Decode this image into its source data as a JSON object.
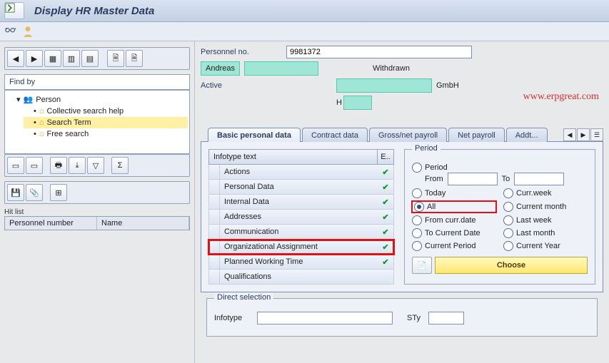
{
  "title": "Display HR Master Data",
  "findby_label": "Find by",
  "tree": {
    "root": "Person",
    "items": [
      "Collective search help",
      "Search Term",
      "Free search"
    ],
    "selected": 1
  },
  "hitlist": {
    "label": "Hit list",
    "col1": "Personnel number",
    "col2": "Name"
  },
  "personnel": {
    "label": "Personnel no.",
    "value": "9981372",
    "name": "Andreas",
    "status": "Withdrawn",
    "active": "Active",
    "company_suffix": "GmbH",
    "line3_prefix": "H"
  },
  "watermark": "www.erpgreat.com",
  "tabs": [
    "Basic personal data",
    "Contract data",
    "Gross/net payroll",
    "Net payroll",
    "Addt..."
  ],
  "active_tab": 0,
  "infotypes": {
    "header": "Infotype text",
    "col2": "E..",
    "rows": [
      {
        "t": "Actions",
        "ok": true
      },
      {
        "t": "Personal Data",
        "ok": true
      },
      {
        "t": "Internal Data",
        "ok": true
      },
      {
        "t": "Addresses",
        "ok": true
      },
      {
        "t": "Communication",
        "ok": true
      },
      {
        "t": "Organizational Assignment",
        "ok": true,
        "hl": true
      },
      {
        "t": "Planned Working Time",
        "ok": true
      },
      {
        "t": "Qualifications",
        "ok": false
      }
    ]
  },
  "period": {
    "legend": "Period",
    "from": "From",
    "to": "To",
    "opts": {
      "period": "Period",
      "today": "Today",
      "currweek": "Curr.week",
      "all": "All",
      "currmonth": "Current month",
      "fromcurr": "From curr.date",
      "lastweek": "Last week",
      "tocurrdate": "To Current Date",
      "lastmonth": "Last month",
      "currperiod": "Current Period",
      "curryear": "Current Year"
    },
    "selected": "all",
    "choose": "Choose"
  },
  "direct": {
    "legend": "Direct selection",
    "infotype": "Infotype",
    "sty": "STy"
  }
}
